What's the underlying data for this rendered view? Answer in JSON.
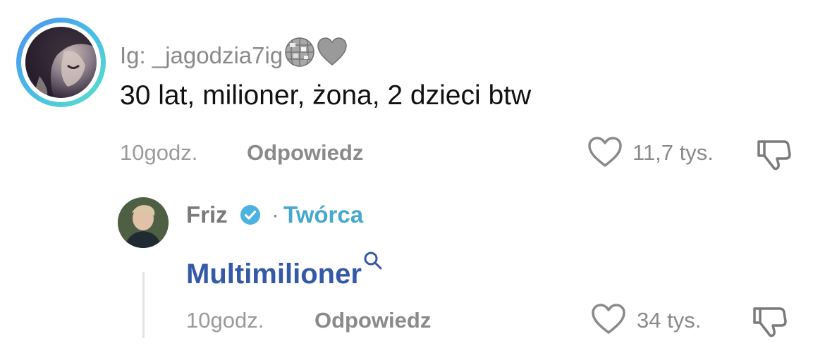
{
  "comment": {
    "username": "Ig: _jagodzia7ig",
    "username_emojis": [
      "disco-ball-icon",
      "grey-heart-icon"
    ],
    "text": "30 lat, milioner, żona, 2 dzieci btw",
    "time": "10godz.",
    "reply_label": "Odpowiedz",
    "likes": "11,7 tys."
  },
  "reply": {
    "username": "Friz",
    "separator": "·",
    "role": "Twórca",
    "text": "Multimilioner",
    "time": "10godz.",
    "reply_label": "Odpowiedz",
    "likes": "34 tys."
  },
  "colors": {
    "muted": "#8a8a8a",
    "creator_badge": "#45a8cc",
    "link_text": "#3459a6",
    "ring_start": "#4f8ff0",
    "ring_end": "#58e3c9"
  }
}
